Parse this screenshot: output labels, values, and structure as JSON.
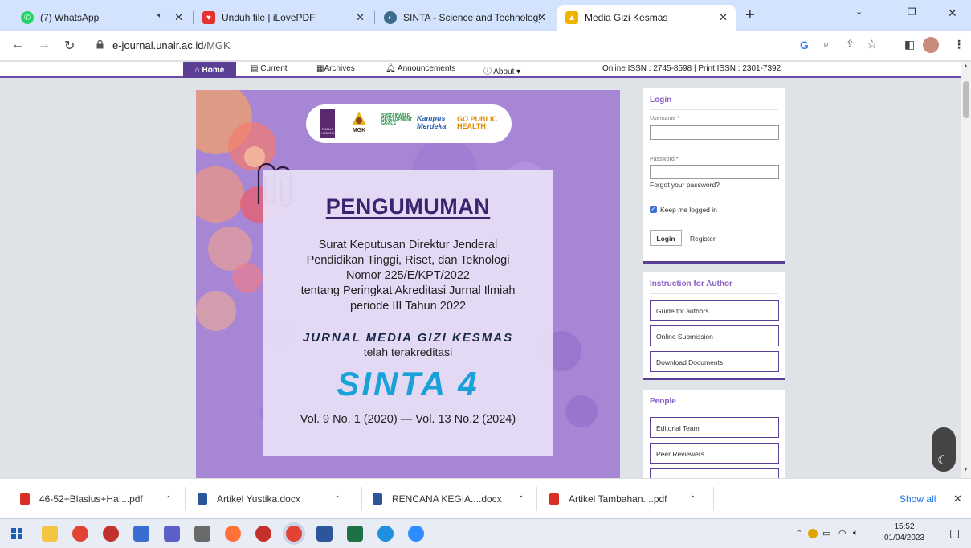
{
  "browser": {
    "tabs": [
      {
        "title": "(7) WhatsApp",
        "favicon": "whatsapp-icon",
        "color": "#25d366"
      },
      {
        "title": "Unduh file | iLovePDF",
        "favicon": "heart-icon",
        "color": "#e5322d"
      },
      {
        "title": "SINTA - Science and Technology",
        "favicon": "sinta-icon",
        "color": "#3d6b8a"
      },
      {
        "title": "Media Gizi Kesmas",
        "favicon": "journal-icon",
        "color": "#f0b400"
      }
    ],
    "new_tab": "+",
    "address": {
      "domain": "e-journal.unair.ac.id",
      "path": "/MGK"
    },
    "profile_letter": "G"
  },
  "site": {
    "nav": {
      "home": "Home",
      "current": "Current",
      "archives": "Archives",
      "announcements": "Announcements",
      "about": "About",
      "issn": "Online ISSN : 2745-8598 | Print ISSN : 2301-7392"
    },
    "banner": {
      "logos": [
        "PUBLIC HEALTH",
        "MGK",
        "SUSTAINABLE DEVELOPMENT GOALS",
        "Kampus Merdeka",
        "GO PUBLIC HEALTH"
      ],
      "heading": "PENGUMUMAN",
      "line1": "Surat Keputusan Direktur Jenderal",
      "line2": "Pendidikan Tinggi, Riset, dan Teknologi",
      "line3": "Nomor 225/E/KPT/2022",
      "line4": "tentang Peringkat Akreditasi Jurnal Ilmiah",
      "line5": "periode III Tahun 2022",
      "journal": "JURNAL MEDIA GIZI KESMAS",
      "accredited": "telah terakreditasi",
      "rank": "SINTA 4",
      "volumes": "Vol. 9 No. 1 (2020) — Vol. 13 No.2 (2024)"
    },
    "login": {
      "title": "Login",
      "username_label": "Username",
      "password_label": "Password",
      "required_mark": "*",
      "forgot": "Forgot your password?",
      "keep": "Keep me logged in",
      "login_button": "Login",
      "register": "Register"
    },
    "instruction": {
      "title": "Instruction for Author",
      "links": [
        "Guide for authors",
        "Online Submission",
        "Download Documents"
      ]
    },
    "people": {
      "title": "People",
      "links": [
        "Editorial Team",
        "Peer Reviewers"
      ]
    }
  },
  "downloads": {
    "items": [
      {
        "name": "46-52+Blasius+Ha....pdf",
        "type": "pdf"
      },
      {
        "name": "Artikel Yustika.docx",
        "type": "docx"
      },
      {
        "name": "RENCANA KEGIA....docx",
        "type": "docx"
      },
      {
        "name": "Artikel Tambahan....pdf",
        "type": "pdf"
      }
    ],
    "show_all": "Show all"
  },
  "taskbar": {
    "time": "15:52",
    "date": "01/04/2023"
  }
}
